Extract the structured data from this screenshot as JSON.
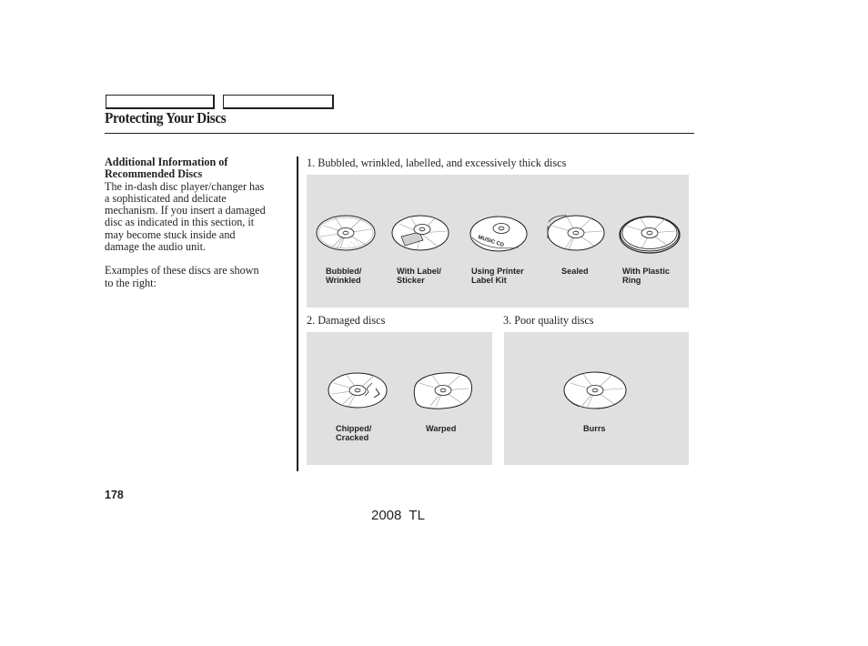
{
  "header": {
    "nav_tabs": [
      "",
      ""
    ],
    "title": "Protecting Your Discs"
  },
  "left_column": {
    "heading_line1": "Additional Information of",
    "heading_line2": "Recommended Discs",
    "paragraph1_lines": [
      "The in-dash disc player/changer has",
      "a sophisticated and delicate",
      "mechanism. If you insert a damaged",
      "disc as indicated in this section, it",
      "may become stuck inside and",
      "damage the audio unit."
    ],
    "paragraph2_lines": [
      "Examples of these discs are shown",
      "to the right:"
    ]
  },
  "sections": [
    {
      "label": "1. Bubbled, wrinkled, labelled, and excessively thick discs",
      "discs": [
        {
          "icon": "bubbled-disc-icon",
          "caption_line1": "Bubbled/",
          "caption_line2": "Wrinkled"
        },
        {
          "icon": "labelled-disc-icon",
          "caption_line1": "With Label/",
          "caption_line2": "Sticker"
        },
        {
          "icon": "printer-label-disc-icon",
          "caption_line1": "Using Printer",
          "caption_line2": "Label Kit",
          "disc_text": "MUSIC CD"
        },
        {
          "icon": "sealed-disc-icon",
          "caption_line1": "Sealed",
          "caption_line2": ""
        },
        {
          "icon": "plastic-ring-disc-icon",
          "caption_line1": "With Plastic",
          "caption_line2": "Ring"
        }
      ]
    },
    {
      "label": "2. Damaged discs",
      "discs": [
        {
          "icon": "chipped-disc-icon",
          "caption_line1": "Chipped/",
          "caption_line2": "Cracked"
        },
        {
          "icon": "warped-disc-icon",
          "caption_line1": "Warped",
          "caption_line2": ""
        }
      ]
    },
    {
      "label": "3. Poor quality discs",
      "discs": [
        {
          "icon": "burrs-disc-icon",
          "caption_line1": "Burrs",
          "caption_line2": ""
        }
      ]
    }
  ],
  "footer": {
    "page_number": "178",
    "model": "2008  TL"
  }
}
